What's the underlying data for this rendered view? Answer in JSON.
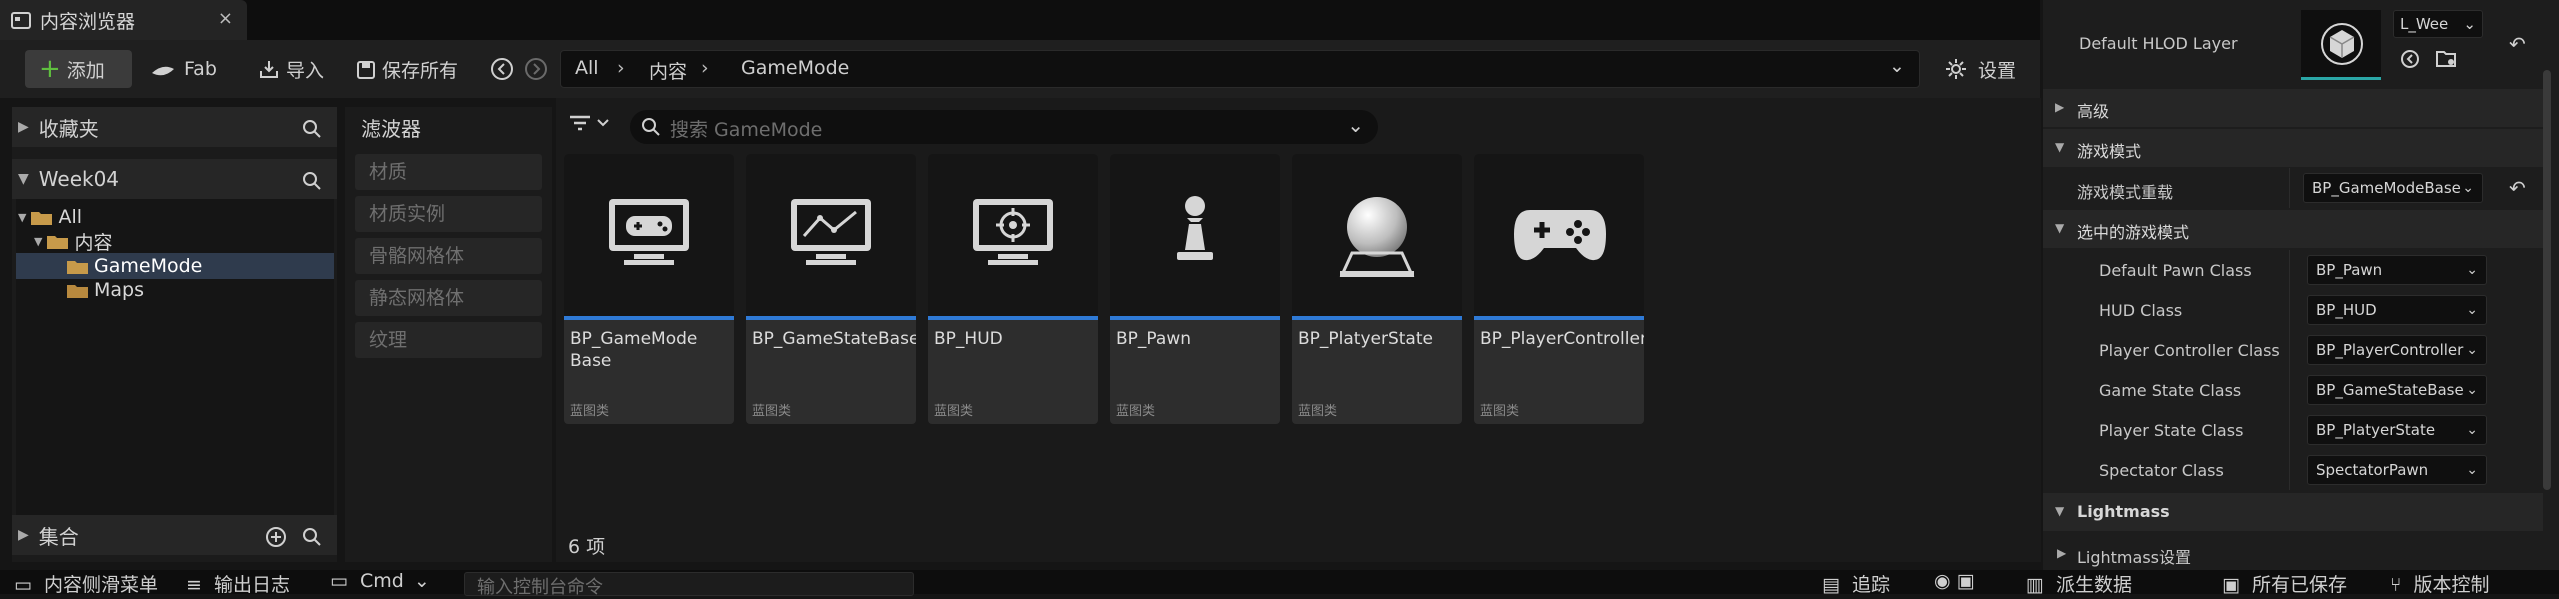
{
  "tab": {
    "title": "内容浏览器",
    "close": "×"
  },
  "toolbar": {
    "add_label": "添加",
    "fab_label": "Fab",
    "import_label": "导入",
    "save_all_label": "保存所有",
    "settings_label": "设置"
  },
  "path": {
    "items": [
      "All",
      "内容",
      "GameMode"
    ]
  },
  "sidebar": {
    "favorites": "收藏夹",
    "project": "Week04",
    "tree": [
      "All",
      "内容",
      "GameMode",
      "Maps"
    ],
    "collections": "集合"
  },
  "filters": {
    "title": "滤波器",
    "items": [
      "材质",
      "材质实例",
      "骨骼网格体",
      "静态网格体",
      "纹理"
    ]
  },
  "search": {
    "placeholder": "搜索 GameMode"
  },
  "assets": [
    {
      "name": "BP_GameMode Base",
      "type": "蓝图类",
      "icon": "gamemode-monitor-icon"
    },
    {
      "name": "BP_GameStateBase",
      "type": "蓝图类",
      "icon": "gamestate-monitor-icon"
    },
    {
      "name": "BP_HUD",
      "type": "蓝图类",
      "icon": "hud-monitor-icon"
    },
    {
      "name": "BP_Pawn",
      "type": "蓝图类",
      "icon": "pawn-icon"
    },
    {
      "name": "BP_PlatyerState",
      "type": "蓝图类",
      "icon": "playerstate-sphere-icon"
    },
    {
      "name": "BP_PlayerController",
      "type": "蓝图类",
      "icon": "gamepad-icon"
    }
  ],
  "count": "6 项",
  "details": {
    "hlod_label": "Default HLOD Layer",
    "hlod_value": "L_Wee",
    "advanced": "高级",
    "game_mode_section": "游戏模式",
    "game_mode_override_label": "游戏模式重载",
    "game_mode_override_value": "BP_GameModeBase",
    "selected_section": "选中的游戏模式",
    "rows": [
      {
        "label": "Default Pawn Class",
        "value": "BP_Pawn"
      },
      {
        "label": "HUD Class",
        "value": "BP_HUD"
      },
      {
        "label": "Player Controller Class",
        "value": "BP_PlayerController"
      },
      {
        "label": "Game State Class",
        "value": "BP_GameStateBase"
      },
      {
        "label": "Player State Class",
        "value": "BP_PlatyerState"
      },
      {
        "label": "Spectator Class",
        "value": "SpectatorPawn"
      }
    ],
    "lightmass": "Lightmass",
    "lightmass_settings": "Lightmass设置"
  },
  "bottom": {
    "content_drawer": "内容侧滑菜单",
    "output_log": "输出日志",
    "cmd": "Cmd",
    "console_placeholder": "输入控制台命令",
    "trace": "追踪",
    "derived_data": "派生数据",
    "all_saved": "所有已保存",
    "source_control": "版本控制"
  },
  "colors": {
    "accent_blue": "#2f7ad6",
    "add_green": "#5fbf3f",
    "folder": "#c79a4a"
  }
}
